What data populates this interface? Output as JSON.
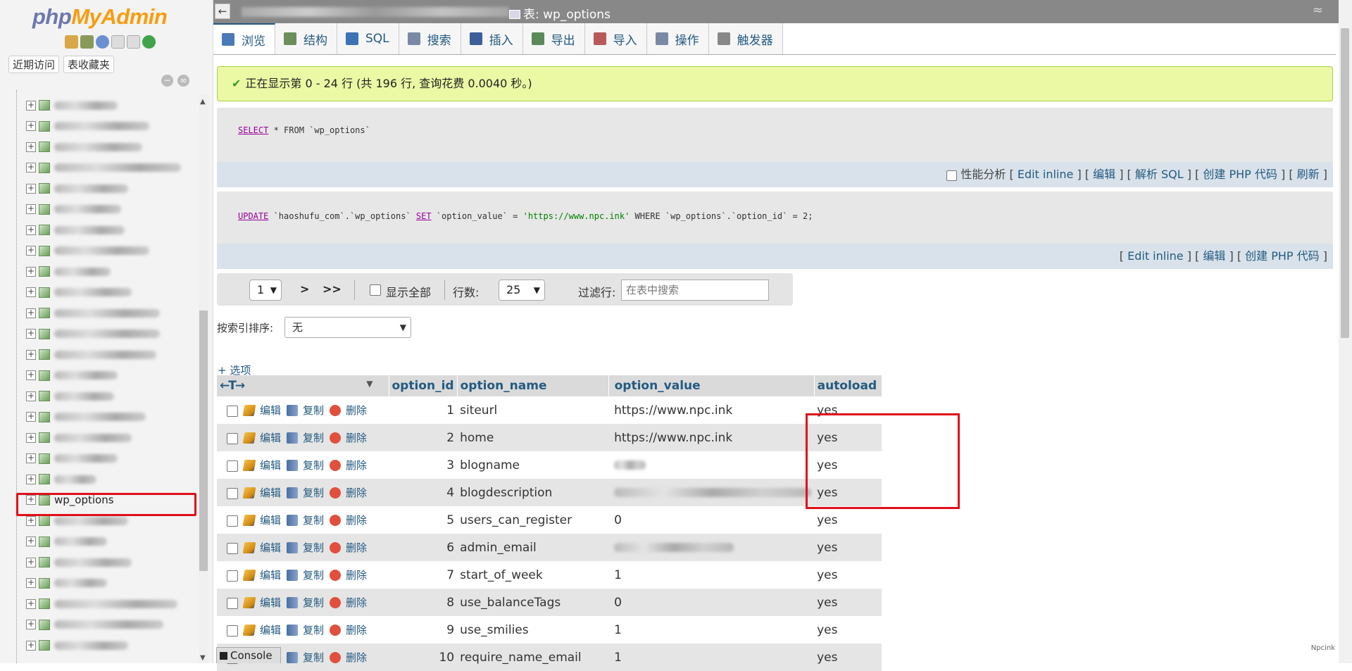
{
  "app": {
    "logo_php": "php",
    "logo_myadmin": "MyAdmin"
  },
  "sidebar": {
    "tabs": [
      "近期访问",
      "表收藏夹"
    ],
    "selected_table": "wp_options"
  },
  "topbar": {
    "back_label": "←",
    "crumb_label": "表: wp_options",
    "collapse_label": "≈"
  },
  "menu": {
    "tabs": [
      {
        "label": "浏览",
        "icon": "browse-icon",
        "color": "#4a7ab8"
      },
      {
        "label": "结构",
        "icon": "structure-icon",
        "color": "#6c8f5a"
      },
      {
        "label": "SQL",
        "icon": "sql-icon",
        "color": "#3b73b5"
      },
      {
        "label": "搜索",
        "icon": "search-icon",
        "color": "#7a8aa6"
      },
      {
        "label": "插入",
        "icon": "insert-icon",
        "color": "#3b5f99"
      },
      {
        "label": "导出",
        "icon": "export-icon",
        "color": "#5a8a5a"
      },
      {
        "label": "导入",
        "icon": "import-icon",
        "color": "#b85a5a"
      },
      {
        "label": "操作",
        "icon": "wrench-icon",
        "color": "#7a8aa6"
      },
      {
        "label": "触发器",
        "icon": "trigger-icon",
        "color": "#888888"
      }
    ]
  },
  "message": {
    "success_text": "正在显示第 0 - 24 行 (共 196 行, 查询花费 0.0040 秒。)"
  },
  "query1": {
    "kw1": "SELECT",
    "rest": " * FROM `wp_options`",
    "profiling_label": "性能分析",
    "actions": [
      "Edit inline",
      "编辑",
      "解析 SQL",
      "创建 PHP 代码",
      "刷新"
    ]
  },
  "query2": {
    "kw1": "UPDATE",
    "part1": " `haoshufu_com`.`wp_options` ",
    "kw2": "SET",
    "part2": " `option_value` = ",
    "str": "'https://www.npc.ink'",
    "part3": " WHERE `wp_options`.`option_id` = 2;",
    "actions": [
      "Edit inline",
      "编辑",
      "创建 PHP 代码"
    ]
  },
  "navigation": {
    "page": "1",
    "next": ">",
    "last": ">>",
    "show_all_label": "显示全部",
    "rows_label": "行数:",
    "rows_value": "25",
    "filter_label": "过滤行:",
    "filter_placeholder": "在表中搜索"
  },
  "sort": {
    "label": "按索引排序:",
    "value": "无"
  },
  "options_link": "+ 选项",
  "table": {
    "headers": [
      "option_id",
      "option_name",
      "option_value",
      "autoload"
    ],
    "actions": [
      "编辑",
      "复制",
      "删除"
    ],
    "rows": [
      {
        "id": "1",
        "name": "siteurl",
        "value": "https://www.npc.ink",
        "autoload": "yes"
      },
      {
        "id": "2",
        "name": "home",
        "value": "https://www.npc.ink",
        "autoload": "yes"
      },
      {
        "id": "3",
        "name": "blogname",
        "value": "",
        "autoload": "yes"
      },
      {
        "id": "4",
        "name": "blogdescription",
        "value": "",
        "autoload": "yes"
      },
      {
        "id": "5",
        "name": "users_can_register",
        "value": "0",
        "autoload": "yes"
      },
      {
        "id": "6",
        "name": "admin_email",
        "value": "",
        "autoload": "yes"
      },
      {
        "id": "7",
        "name": "start_of_week",
        "value": "1",
        "autoload": "yes"
      },
      {
        "id": "8",
        "name": "use_balanceTags",
        "value": "0",
        "autoload": "yes"
      },
      {
        "id": "9",
        "name": "use_smilies",
        "value": "1",
        "autoload": "yes"
      },
      {
        "id": "10",
        "name": "require_name_email",
        "value": "1",
        "autoload": "yes"
      }
    ]
  },
  "console_label": "Console",
  "watermark": "Npcink"
}
